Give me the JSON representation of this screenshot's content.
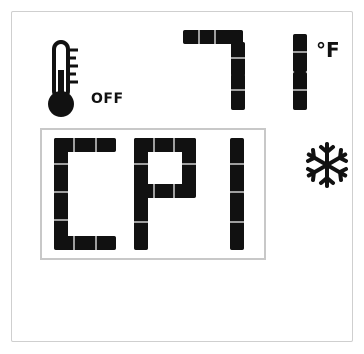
{
  "display": {
    "power_status": "OFF",
    "temperature": "71",
    "temperature_unit": "°F",
    "mode_code": "CP1"
  },
  "icons": {
    "thermometer": "thermometer-icon",
    "snowflake": "snowflake-icon"
  },
  "colors": {
    "segment": "#111111",
    "frame": "#c8c8c8",
    "background": "#ffffff"
  }
}
